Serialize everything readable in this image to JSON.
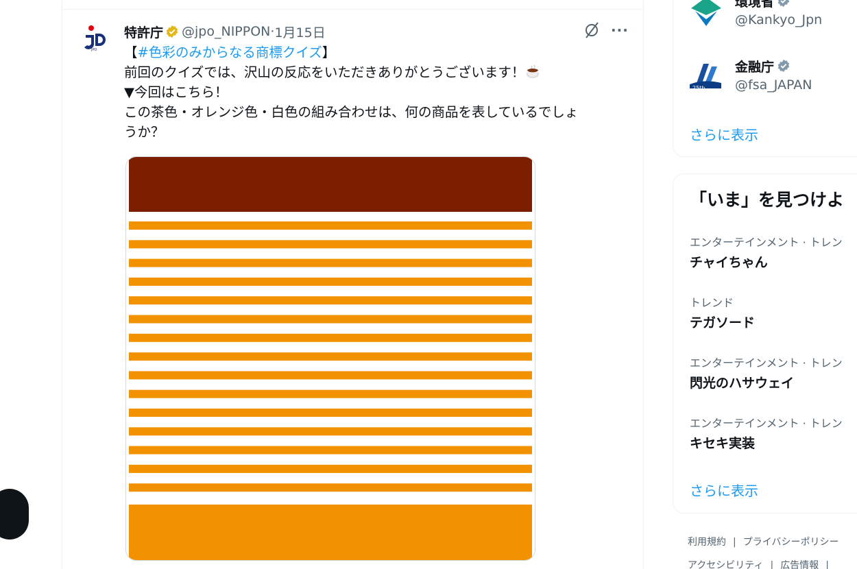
{
  "tweet": {
    "author_name": "特許庁",
    "handle": "@jpo_NIPPON",
    "date": "1月15日",
    "meta_sep": " · ",
    "text_lines": {
      "l1_open": "【",
      "l1_hashtag": "#色彩のみからなる商標クイズ",
      "l1_close": "】",
      "l2": "前回のクイズでは、沢山の反応をいただきありがとうございます！",
      "l3": "▼今回はこちら！",
      "l4": "この茶色・オレンジ色・白色の組み合わせは、何の商品を表しているでしょ",
      "l5": "うか？"
    },
    "image_colors": {
      "brown": "#7b1f00",
      "orange": "#f39200",
      "white": "#ffffff"
    },
    "icons": [
      "jpo-logo-icon",
      "verified-gold-icon",
      "grok-icon",
      "more-icon",
      "coffee-icon"
    ]
  },
  "sidebar": {
    "accounts": [
      {
        "name": "環境省",
        "handle": "@Kankyo_Jpn"
      },
      {
        "name": "金融庁",
        "handle": "@fsa_JAPAN"
      }
    ],
    "show_more": "さらに表示",
    "trends_title": "「いま」を見つけよ",
    "trends": [
      {
        "category": "エンターテインメント · トレン",
        "name": "チャイちゃん"
      },
      {
        "category": "トレンド",
        "name": "テガソード"
      },
      {
        "category": "エンターテインメント · トレン",
        "name": "閃光のハサウェイ"
      },
      {
        "category": "エンターテインメント · トレン",
        "name": "キセキ実装"
      }
    ],
    "trends_show_more": "さらに表示"
  },
  "footer": {
    "links_row1": [
      "利用規約",
      "プライバシーポリシー"
    ],
    "links_row2": [
      "アクセシビリティ",
      "広告情報"
    ],
    "separator": "|"
  },
  "colors": {
    "accent": "#1d9bf0",
    "text": "#0f1419",
    "muted": "#536471",
    "verified_gold": "#e2b719",
    "verified_gray": "#829aab"
  }
}
